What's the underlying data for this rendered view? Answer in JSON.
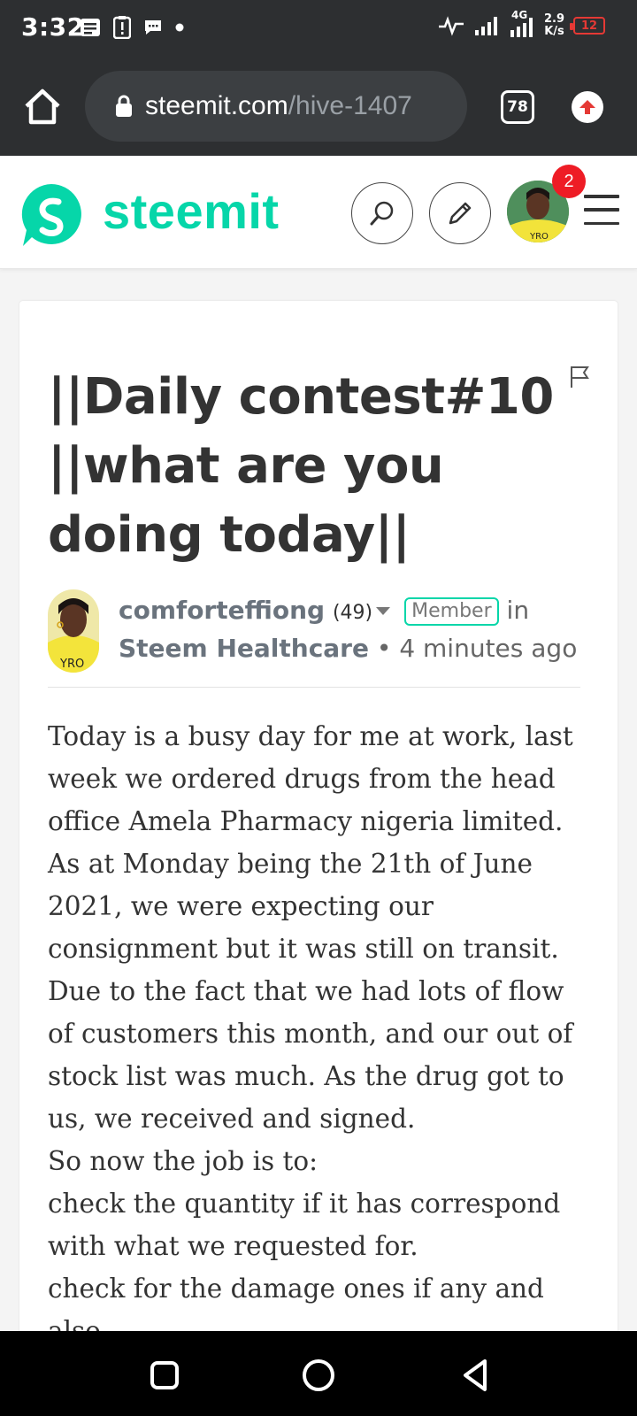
{
  "status_bar": {
    "time": "3:32",
    "network": "4G",
    "speed_value": "2.9",
    "speed_unit": "K/s",
    "battery": "12"
  },
  "browser": {
    "url_domain": "steemit.com",
    "url_path": "/hive-1407",
    "tab_count": "78"
  },
  "site": {
    "brand": "steemit",
    "notification_count": "2",
    "accent_color": "#06d6a9"
  },
  "post": {
    "title": "||Daily contest#10 ||what are you doing today||",
    "author": "comforteffiong",
    "reputation": "(49)",
    "badge": "Member",
    "in_label": "in",
    "community": "Steem Healthcare",
    "separator": "•",
    "timestamp": "4 minutes ago",
    "body": [
      "Today is a busy day for me at work, last week we ordered drugs from the head office Amela Pharmacy nigeria limited.",
      "As at Monday being the 21th of June 2021, we were expecting our consignment but it was still on transit.",
      "Due to the fact that we had lots of flow of customers this month, and our out of stock list was much. As the drug got to us, we received and signed.",
      "So now the job is to:",
      "check the quantity if it has correspond with what we requested for.",
      "check for the damage ones if any and also"
    ]
  }
}
